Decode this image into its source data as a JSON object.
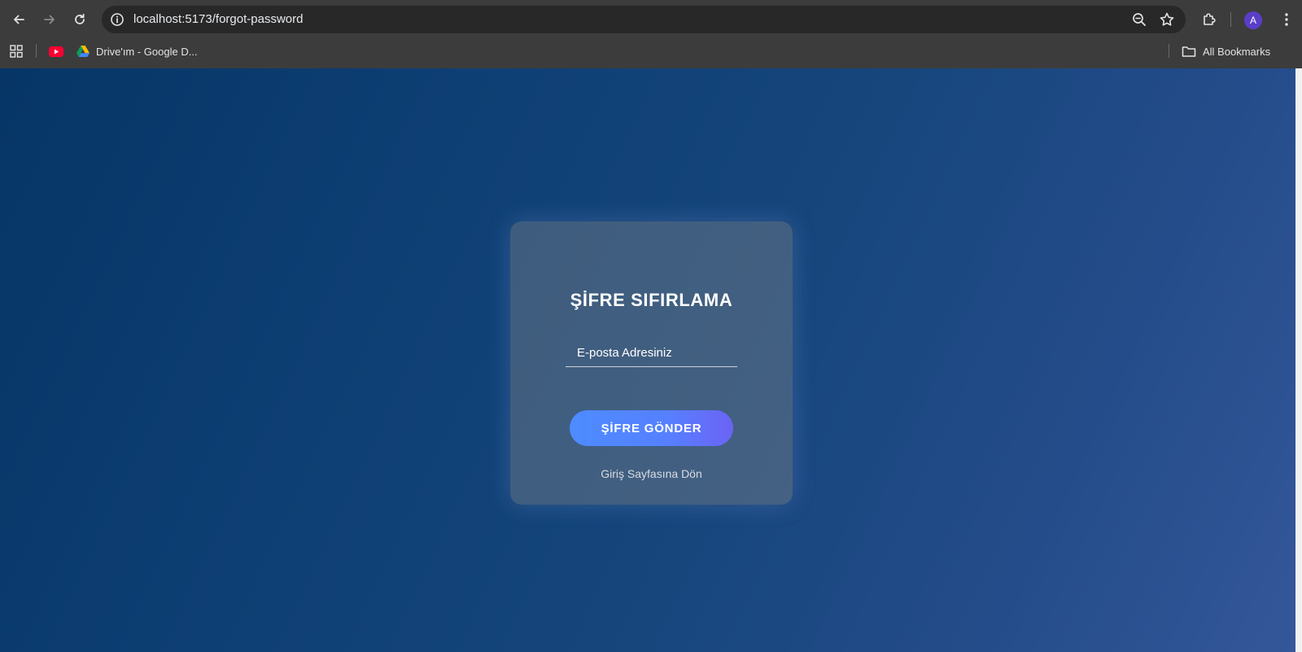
{
  "browser": {
    "url": "localhost:5173/forgot-password",
    "avatar_initial": "A",
    "bookmarks": [
      {
        "label": "",
        "icon": "youtube-icon"
      },
      {
        "label": "Drive'ım - Google D...",
        "icon": "google-drive-icon"
      }
    ],
    "all_bookmarks_label": "All Bookmarks"
  },
  "page": {
    "title": "ŞİFRE SIFIRLAMA",
    "email_placeholder": "E-posta Adresiniz",
    "send_button_label": "ŞİFRE GÖNDER",
    "back_link_label": "Giriş Sayfasına Dön"
  },
  "colors": {
    "background_gradient_start": "#063566",
    "background_gradient_end": "#34579a",
    "button_gradient_start": "#4d8cff",
    "button_gradient_end": "#6b63f5"
  }
}
